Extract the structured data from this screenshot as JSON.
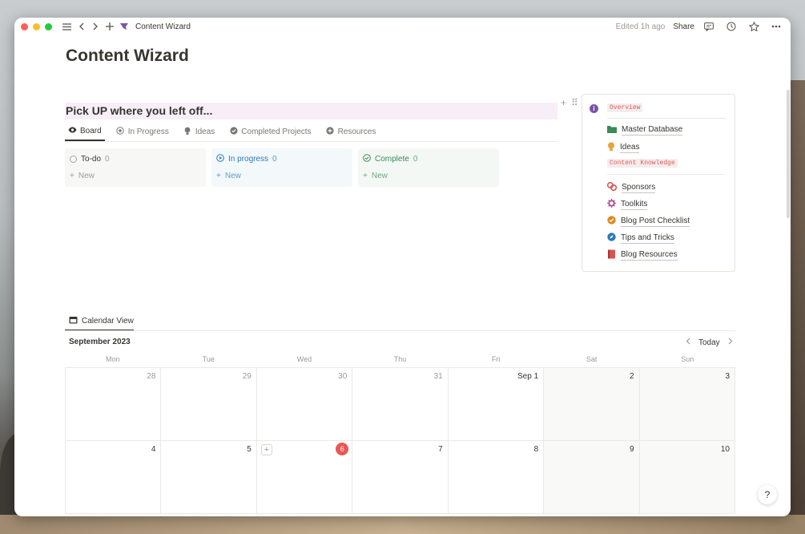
{
  "window": {
    "title": "Content Wizard",
    "edited": "Edited 1h ago",
    "share_label": "Share"
  },
  "page": {
    "title": "Content Wizard",
    "section_header": "Pick UP where you left off..."
  },
  "tabs": [
    {
      "label": "Board",
      "icon": "eye-icon",
      "active": true
    },
    {
      "label": "In Progress",
      "icon": "in-progress-icon",
      "active": false
    },
    {
      "label": "Ideas",
      "icon": "lightbulb-icon",
      "active": false
    },
    {
      "label": "Completed Projects",
      "icon": "check-circle-icon",
      "active": false
    },
    {
      "label": "Resources",
      "icon": "plus-circle-icon",
      "active": false
    }
  ],
  "board": {
    "columns": [
      {
        "title": "To-do",
        "count": "0",
        "new_label": "New"
      },
      {
        "title": "In progress",
        "count": "0",
        "new_label": "New"
      },
      {
        "title": "Complete",
        "count": "0",
        "new_label": "New"
      }
    ]
  },
  "side_panel": {
    "overview_tag": "Overview",
    "links_a": [
      {
        "label": "Master Database",
        "icon": "folder-icon",
        "color": "#3b8a5a"
      },
      {
        "label": "Ideas",
        "icon": "lightbulb-icon",
        "color": "#e8a33d"
      }
    ],
    "knowledge_tag": "Content Knowledge",
    "links_b": [
      {
        "label": "Sponsors",
        "icon": "coins-icon",
        "color": "#d9534f"
      },
      {
        "label": "Toolkits",
        "icon": "gear-icon",
        "color": "#b44a9c"
      },
      {
        "label": "Blog Post Checklist",
        "icon": "check-badge-icon",
        "color": "#e08a1e"
      },
      {
        "label": "Tips and Tricks",
        "icon": "compass-icon",
        "color": "#2e7ab8"
      },
      {
        "label": "Blog Resources",
        "icon": "book-icon",
        "color": "#d9534f"
      }
    ]
  },
  "calendar": {
    "tab_label": "Calendar View",
    "month": "September 2023",
    "today_label": "Today",
    "weekdays": [
      "Mon",
      "Tue",
      "Wed",
      "Thu",
      "Fri",
      "Sat",
      "Sun"
    ],
    "days": [
      "28",
      "29",
      "30",
      "31",
      "Sep 1",
      "2",
      "3",
      "4",
      "5",
      "6",
      "7",
      "8",
      "9",
      "10"
    ],
    "today": "6"
  },
  "help_label": "?"
}
